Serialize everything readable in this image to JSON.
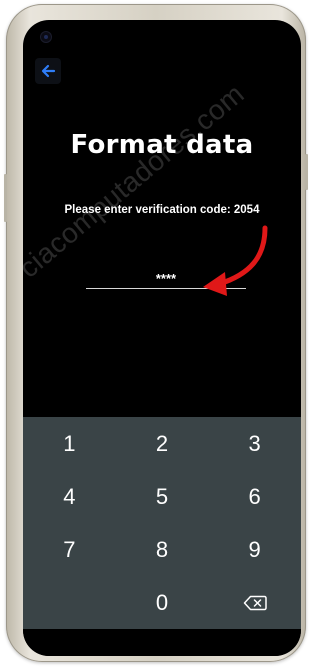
{
  "screen": {
    "title": "Format data",
    "prompt": "Please enter verification code: 2054",
    "code_value": "****",
    "watermark": "ciacomputadores.com"
  },
  "icons": {
    "back": "back-arrow-icon",
    "backspace": "backspace-icon",
    "annotation": "red-arrow-icon"
  },
  "colors": {
    "back_arrow": "#2f7df6",
    "keypad_bg": "#3a4447",
    "annotation_arrow": "#e01818"
  },
  "keypad": {
    "key_1": "1",
    "key_2": "2",
    "key_3": "3",
    "key_4": "4",
    "key_5": "5",
    "key_6": "6",
    "key_7": "7",
    "key_8": "8",
    "key_9": "9",
    "key_0": "0"
  }
}
